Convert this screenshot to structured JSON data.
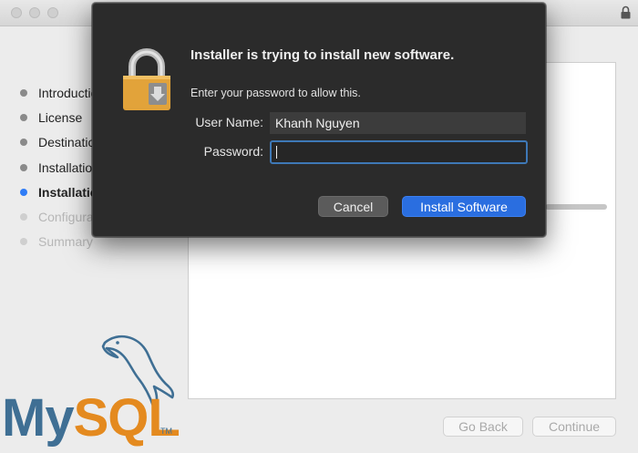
{
  "installer": {
    "steps": [
      {
        "label": "Introduction",
        "state": "done"
      },
      {
        "label": "License",
        "state": "done"
      },
      {
        "label": "Destination Select",
        "state": "done"
      },
      {
        "label": "Installation Type",
        "state": "done"
      },
      {
        "label": "Installation",
        "state": "current"
      },
      {
        "label": "Configuration",
        "state": "future"
      },
      {
        "label": "Summary",
        "state": "future"
      }
    ],
    "go_back_label": "Go Back",
    "continue_label": "Continue",
    "logo": {
      "my": "My",
      "sql": "SQL",
      "tm": "TM"
    }
  },
  "auth_dialog": {
    "title": "Installer is trying to install new software.",
    "subtitle": "Enter your password to allow this.",
    "username_label": "User Name:",
    "username_value": "Khanh Nguyen",
    "password_label": "Password:",
    "password_value": "",
    "cancel_label": "Cancel",
    "install_label": "Install Software",
    "icons": {
      "dialog": "lock-icon"
    }
  },
  "colors": {
    "accent": "#2a6ee0",
    "current_step_dot": "#2f7cf6",
    "mysql_blue": "#3f6f94",
    "mysql_orange": "#e48a1f"
  }
}
